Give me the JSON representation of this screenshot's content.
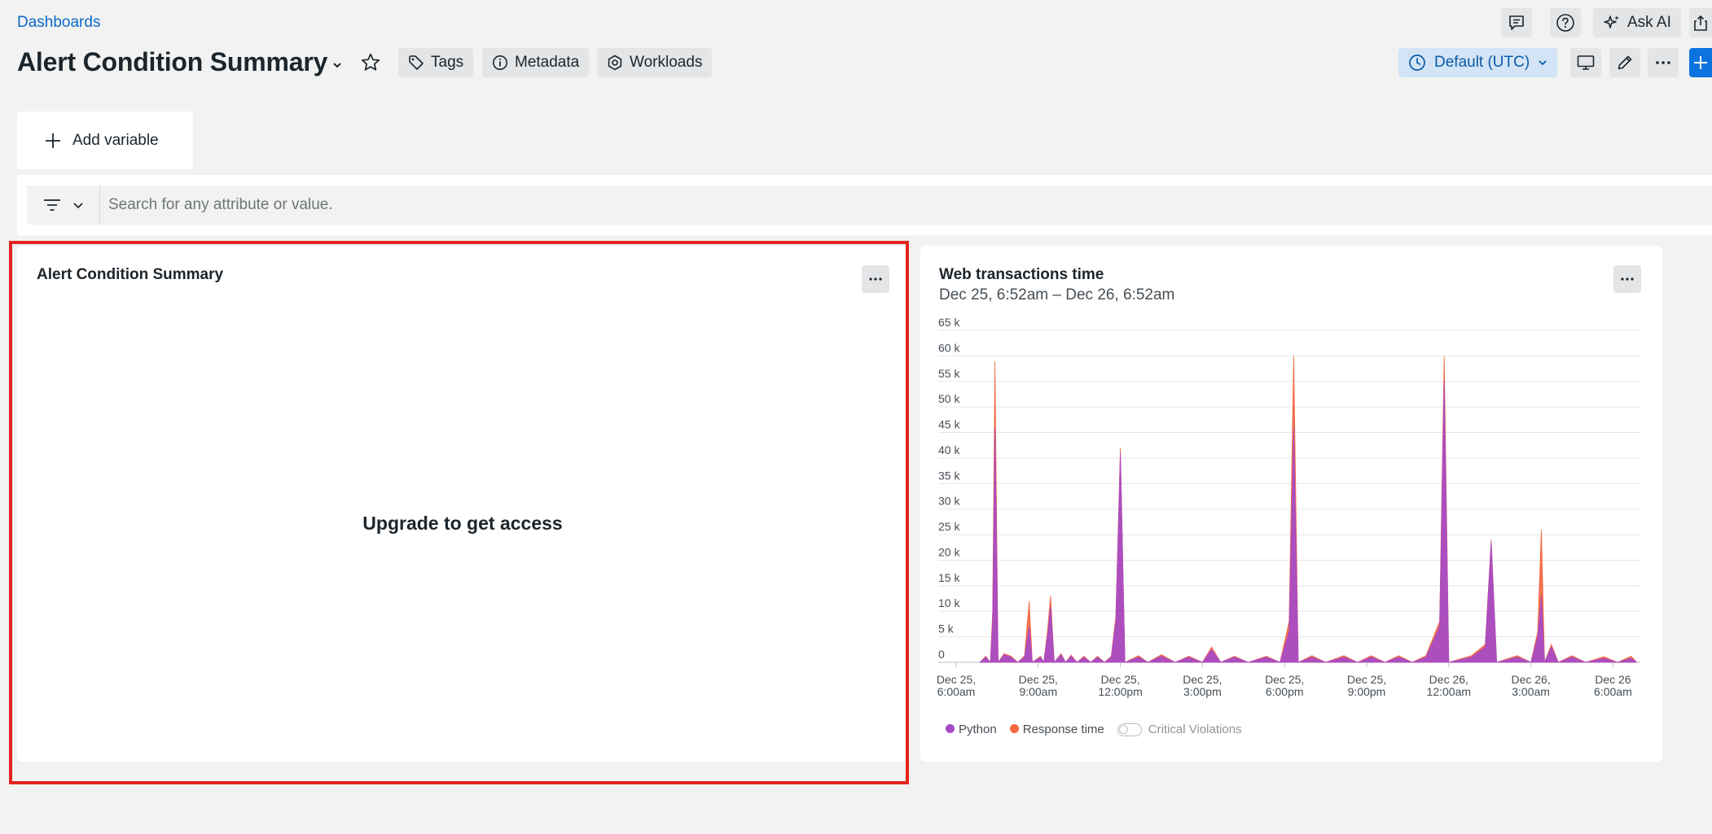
{
  "header": {
    "breadcrumb": "Dashboards",
    "title": "Alert Condition Summary",
    "tags_label": "Tags",
    "metadata_label": "Metadata",
    "workloads_label": "Workloads",
    "ask_ai_label": "Ask AI",
    "timezone_label": "Default (UTC)"
  },
  "variables": {
    "add_label": "Add variable"
  },
  "filter": {
    "placeholder": "Search for any attribute or value."
  },
  "widget_left": {
    "title": "Alert Condition Summary",
    "message": "Upgrade to get access"
  },
  "widget_right": {
    "title": "Web transactions time",
    "subtitle": "Dec 25, 6:52am – Dec 26, 6:52am",
    "legend": [
      {
        "name": "Python",
        "color": "#a64bc8"
      },
      {
        "name": "Response time",
        "color": "#f4663f"
      }
    ],
    "toggle_label": "Critical Violations"
  },
  "colors": {
    "accent": "#0b6acb",
    "highlight": "#e3241e",
    "python": "#a64bc8",
    "response": "#f4663f"
  },
  "chart_data": {
    "type": "area",
    "title": "Web transactions time",
    "ylim": [
      0,
      65000
    ],
    "y_ticks": [
      "0",
      "5 k",
      "10 k",
      "15 k",
      "20 k",
      "25 k",
      "30 k",
      "35 k",
      "40 k",
      "45 k",
      "50 k",
      "55 k",
      "60 k",
      "65 k"
    ],
    "x_range": [
      "2024-12-25T06:00",
      "2024-12-26T07:00"
    ],
    "x_ticks": [
      {
        "t": "2024-12-25T06:00",
        "l1": "Dec 25,",
        "l2": "6:00am"
      },
      {
        "t": "2024-12-25T09:00",
        "l1": "Dec 25,",
        "l2": "9:00am"
      },
      {
        "t": "2024-12-25T12:00",
        "l1": "Dec 25,",
        "l2": "12:00pm"
      },
      {
        "t": "2024-12-25T15:00",
        "l1": "Dec 25,",
        "l2": "3:00pm"
      },
      {
        "t": "2024-12-25T18:00",
        "l1": "Dec 25,",
        "l2": "6:00pm"
      },
      {
        "t": "2024-12-25T21:00",
        "l1": "Dec 25,",
        "l2": "9:00pm"
      },
      {
        "t": "2024-12-26T00:00",
        "l1": "Dec 26,",
        "l2": "12:00am"
      },
      {
        "t": "2024-12-26T03:00",
        "l1": "Dec 26,",
        "l2": "3:00am"
      },
      {
        "t": "2024-12-26T06:00",
        "l1": "Dec 26",
        "l2": "6:00am"
      }
    ],
    "series": [
      {
        "name": "Python",
        "color": "#a64bc8",
        "points": [
          [
            "2024-12-25T06:52",
            0
          ],
          [
            "2024-12-25T07:05",
            1000
          ],
          [
            "2024-12-25T07:15",
            0
          ],
          [
            "2024-12-25T07:20",
            8000
          ],
          [
            "2024-12-25T07:25",
            46000
          ],
          [
            "2024-12-25T07:32",
            0
          ],
          [
            "2024-12-25T07:45",
            1500
          ],
          [
            "2024-12-25T08:00",
            1000
          ],
          [
            "2024-12-25T08:15",
            0
          ],
          [
            "2024-12-25T08:30",
            1000
          ],
          [
            "2024-12-25T08:40",
            7000
          ],
          [
            "2024-12-25T08:47",
            0
          ],
          [
            "2024-12-25T09:05",
            1000
          ],
          [
            "2024-12-25T09:12",
            0
          ],
          [
            "2024-12-25T09:20",
            5000
          ],
          [
            "2024-12-25T09:27",
            11000
          ],
          [
            "2024-12-25T09:35",
            0
          ],
          [
            "2024-12-25T09:50",
            1500
          ],
          [
            "2024-12-25T10:00",
            0
          ],
          [
            "2024-12-25T10:12",
            1200
          ],
          [
            "2024-12-25T10:25",
            0
          ],
          [
            "2024-12-25T10:40",
            1000
          ],
          [
            "2024-12-25T10:55",
            0
          ],
          [
            "2024-12-25T11:10",
            1000
          ],
          [
            "2024-12-25T11:25",
            0
          ],
          [
            "2024-12-25T11:40",
            1000
          ],
          [
            "2024-12-25T11:50",
            8000
          ],
          [
            "2024-12-25T12:00",
            41000
          ],
          [
            "2024-12-25T12:10",
            0
          ],
          [
            "2024-12-25T12:40",
            1000
          ],
          [
            "2024-12-25T13:00",
            0
          ],
          [
            "2024-12-25T13:30",
            1200
          ],
          [
            "2024-12-25T14:00",
            0
          ],
          [
            "2024-12-25T14:30",
            1000
          ],
          [
            "2024-12-25T15:00",
            0
          ],
          [
            "2024-12-25T15:20",
            2500
          ],
          [
            "2024-12-25T15:40",
            0
          ],
          [
            "2024-12-25T16:10",
            1000
          ],
          [
            "2024-12-25T16:40",
            0
          ],
          [
            "2024-12-25T17:20",
            1000
          ],
          [
            "2024-12-25T17:50",
            0
          ],
          [
            "2024-12-25T18:10",
            6000
          ],
          [
            "2024-12-25T18:20",
            46000
          ],
          [
            "2024-12-25T18:30",
            0
          ],
          [
            "2024-12-25T19:00",
            1000
          ],
          [
            "2024-12-25T19:30",
            0
          ],
          [
            "2024-12-25T20:10",
            1000
          ],
          [
            "2024-12-25T20:40",
            0
          ],
          [
            "2024-12-25T21:10",
            1000
          ],
          [
            "2024-12-25T21:40",
            0
          ],
          [
            "2024-12-25T22:10",
            1000
          ],
          [
            "2024-12-25T22:40",
            0
          ],
          [
            "2024-12-25T23:10",
            1000
          ],
          [
            "2024-12-25T23:40",
            7000
          ],
          [
            "2024-12-25T23:50",
            55000
          ],
          [
            "2024-12-26T00:00",
            0
          ],
          [
            "2024-12-26T00:50",
            1000
          ],
          [
            "2024-12-26T01:20",
            3000
          ],
          [
            "2024-12-26T01:33",
            23500
          ],
          [
            "2024-12-26T01:45",
            0
          ],
          [
            "2024-12-26T02:30",
            1000
          ],
          [
            "2024-12-26T03:00",
            0
          ],
          [
            "2024-12-26T03:15",
            5000
          ],
          [
            "2024-12-26T03:23",
            13000
          ],
          [
            "2024-12-26T03:30",
            0
          ],
          [
            "2024-12-26T03:45",
            3000
          ],
          [
            "2024-12-26T04:00",
            0
          ],
          [
            "2024-12-26T04:30",
            1000
          ],
          [
            "2024-12-26T05:00",
            0
          ],
          [
            "2024-12-26T05:40",
            800
          ],
          [
            "2024-12-26T06:10",
            0
          ],
          [
            "2024-12-26T06:40",
            800
          ],
          [
            "2024-12-26T06:52",
            0
          ]
        ]
      },
      {
        "name": "Response time",
        "color": "#f4663f",
        "points": [
          [
            "2024-12-25T06:52",
            0
          ],
          [
            "2024-12-25T07:05",
            1200
          ],
          [
            "2024-12-25T07:15",
            0
          ],
          [
            "2024-12-25T07:20",
            10000
          ],
          [
            "2024-12-25T07:25",
            59000
          ],
          [
            "2024-12-25T07:32",
            0
          ],
          [
            "2024-12-25T07:45",
            1700
          ],
          [
            "2024-12-25T08:00",
            1200
          ],
          [
            "2024-12-25T08:15",
            0
          ],
          [
            "2024-12-25T08:30",
            1300
          ],
          [
            "2024-12-25T08:40",
            12000
          ],
          [
            "2024-12-25T08:47",
            0
          ],
          [
            "2024-12-25T09:05",
            1200
          ],
          [
            "2024-12-25T09:12",
            0
          ],
          [
            "2024-12-25T09:20",
            6000
          ],
          [
            "2024-12-25T09:27",
            13000
          ],
          [
            "2024-12-25T09:35",
            0
          ],
          [
            "2024-12-25T09:50",
            1700
          ],
          [
            "2024-12-25T10:00",
            0
          ],
          [
            "2024-12-25T10:12",
            1400
          ],
          [
            "2024-12-25T10:25",
            0
          ],
          [
            "2024-12-25T10:40",
            1200
          ],
          [
            "2024-12-25T10:55",
            0
          ],
          [
            "2024-12-25T11:10",
            1200
          ],
          [
            "2024-12-25T11:25",
            0
          ],
          [
            "2024-12-25T11:40",
            1200
          ],
          [
            "2024-12-25T11:50",
            9000
          ],
          [
            "2024-12-25T12:00",
            42000
          ],
          [
            "2024-12-25T12:10",
            0
          ],
          [
            "2024-12-25T12:40",
            1300
          ],
          [
            "2024-12-25T13:00",
            0
          ],
          [
            "2024-12-25T13:30",
            1500
          ],
          [
            "2024-12-25T14:00",
            0
          ],
          [
            "2024-12-25T14:30",
            1200
          ],
          [
            "2024-12-25T15:00",
            0
          ],
          [
            "2024-12-25T15:20",
            3000
          ],
          [
            "2024-12-25T15:40",
            0
          ],
          [
            "2024-12-25T16:10",
            1200
          ],
          [
            "2024-12-25T16:40",
            0
          ],
          [
            "2024-12-25T17:20",
            1200
          ],
          [
            "2024-12-25T17:50",
            0
          ],
          [
            "2024-12-25T18:10",
            8000
          ],
          [
            "2024-12-25T18:20",
            60000
          ],
          [
            "2024-12-25T18:30",
            0
          ],
          [
            "2024-12-25T19:00",
            1300
          ],
          [
            "2024-12-25T19:30",
            0
          ],
          [
            "2024-12-25T20:10",
            1300
          ],
          [
            "2024-12-25T20:40",
            0
          ],
          [
            "2024-12-25T21:10",
            1300
          ],
          [
            "2024-12-25T21:40",
            0
          ],
          [
            "2024-12-25T22:10",
            1300
          ],
          [
            "2024-12-25T22:40",
            0
          ],
          [
            "2024-12-25T23:10",
            1300
          ],
          [
            "2024-12-25T23:40",
            8000
          ],
          [
            "2024-12-25T23:50",
            60000
          ],
          [
            "2024-12-26T00:00",
            0
          ],
          [
            "2024-12-26T00:50",
            1300
          ],
          [
            "2024-12-26T01:20",
            3500
          ],
          [
            "2024-12-26T01:33",
            24000
          ],
          [
            "2024-12-26T01:45",
            0
          ],
          [
            "2024-12-26T02:30",
            1300
          ],
          [
            "2024-12-26T03:00",
            0
          ],
          [
            "2024-12-26T03:15",
            6000
          ],
          [
            "2024-12-26T03:23",
            26000
          ],
          [
            "2024-12-26T03:30",
            0
          ],
          [
            "2024-12-26T03:45",
            3500
          ],
          [
            "2024-12-26T04:00",
            0
          ],
          [
            "2024-12-26T04:30",
            1300
          ],
          [
            "2024-12-26T05:00",
            0
          ],
          [
            "2024-12-26T05:40",
            1100
          ],
          [
            "2024-12-26T06:10",
            0
          ],
          [
            "2024-12-26T06:40",
            1200
          ],
          [
            "2024-12-26T06:52",
            0
          ]
        ]
      }
    ]
  }
}
